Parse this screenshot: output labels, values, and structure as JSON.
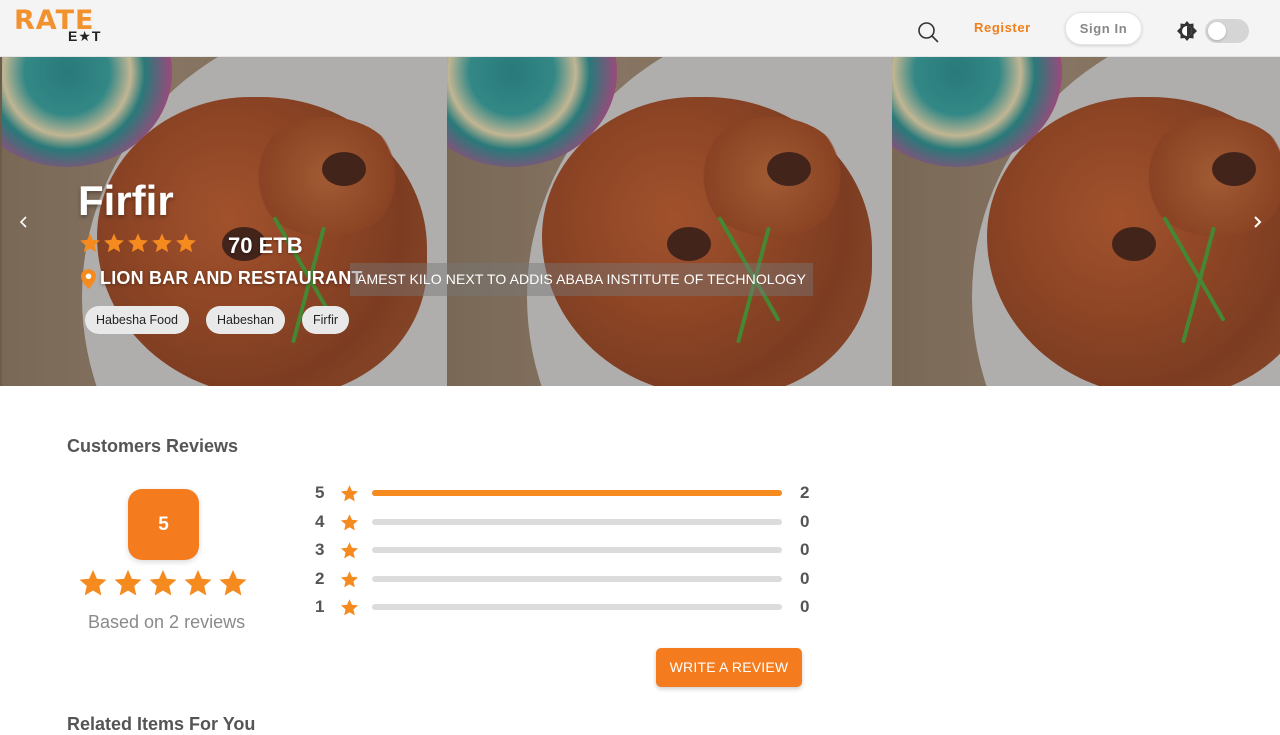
{
  "header": {
    "logo_top": "RATE",
    "logo_bottom": "E★T",
    "register_label": "Register",
    "signin_label": "Sign In",
    "icons": [
      "search-icon",
      "theme-brightness-icon"
    ]
  },
  "hero": {
    "title": "Firfir",
    "rating": 5,
    "price": "70 ETB",
    "restaurant": "LION BAR AND RESTAURANT",
    "address": "AMEST KILO NEXT TO ADDIS ABABA INSTITUTE OF TECHNOLOGY",
    "tags": [
      "Habesha Food",
      "Habeshan",
      "Firfir"
    ],
    "icons": [
      "chevron-left-icon",
      "chevron-right-icon",
      "location-pin-icon"
    ]
  },
  "reviews": {
    "title": "Customers Reviews",
    "average": "5",
    "average_stars": 5,
    "based_on": "Based on 2 reviews",
    "rows": [
      {
        "stars": "5",
        "count": "2",
        "fraction": 1.0
      },
      {
        "stars": "4",
        "count": "0",
        "fraction": 0
      },
      {
        "stars": "3",
        "count": "0",
        "fraction": 0
      },
      {
        "stars": "2",
        "count": "0",
        "fraction": 0
      },
      {
        "stars": "1",
        "count": "0",
        "fraction": 0
      }
    ],
    "write_review_label": "WRITE A REVIEW"
  },
  "related": {
    "title": "Related Items For You"
  },
  "colors": {
    "accent": "#f47c1e",
    "star": "#f58a1f",
    "header_bg": "#f4f4f4"
  }
}
